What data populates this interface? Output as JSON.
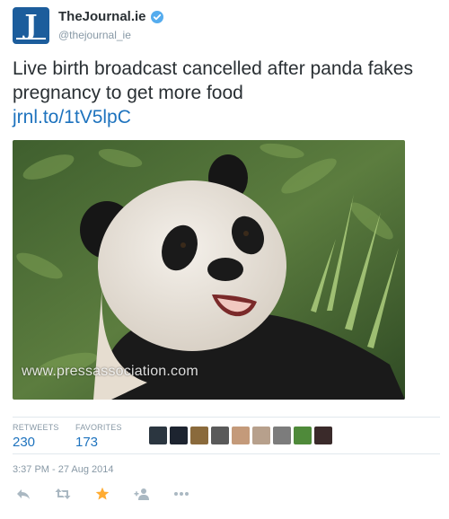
{
  "account": {
    "name": "TheJournal.ie",
    "handle": "@thejournal_ie",
    "avatar_letter": "J",
    "avatar_color": "#1c5d9c",
    "verified": true
  },
  "tweet": {
    "text": "Live birth broadcast cancelled after panda fakes pregnancy to get more food",
    "link": "jrnl.to/1tV5lpC"
  },
  "photo": {
    "watermark": "www.pressassociation.com"
  },
  "stats": {
    "retweets_label": "RETWEETS",
    "retweets_count": "230",
    "favorites_label": "FAVORITES",
    "favorites_count": "173"
  },
  "timestamp": "3:37 PM - 27 Aug 2014",
  "actions": [
    "reply-icon",
    "retweet-icon",
    "favorite-icon",
    "follow-icon",
    "more-icon"
  ],
  "colors": {
    "link": "#1e73be",
    "favorite_active": "#ffac33",
    "muted": "#8899a6"
  }
}
